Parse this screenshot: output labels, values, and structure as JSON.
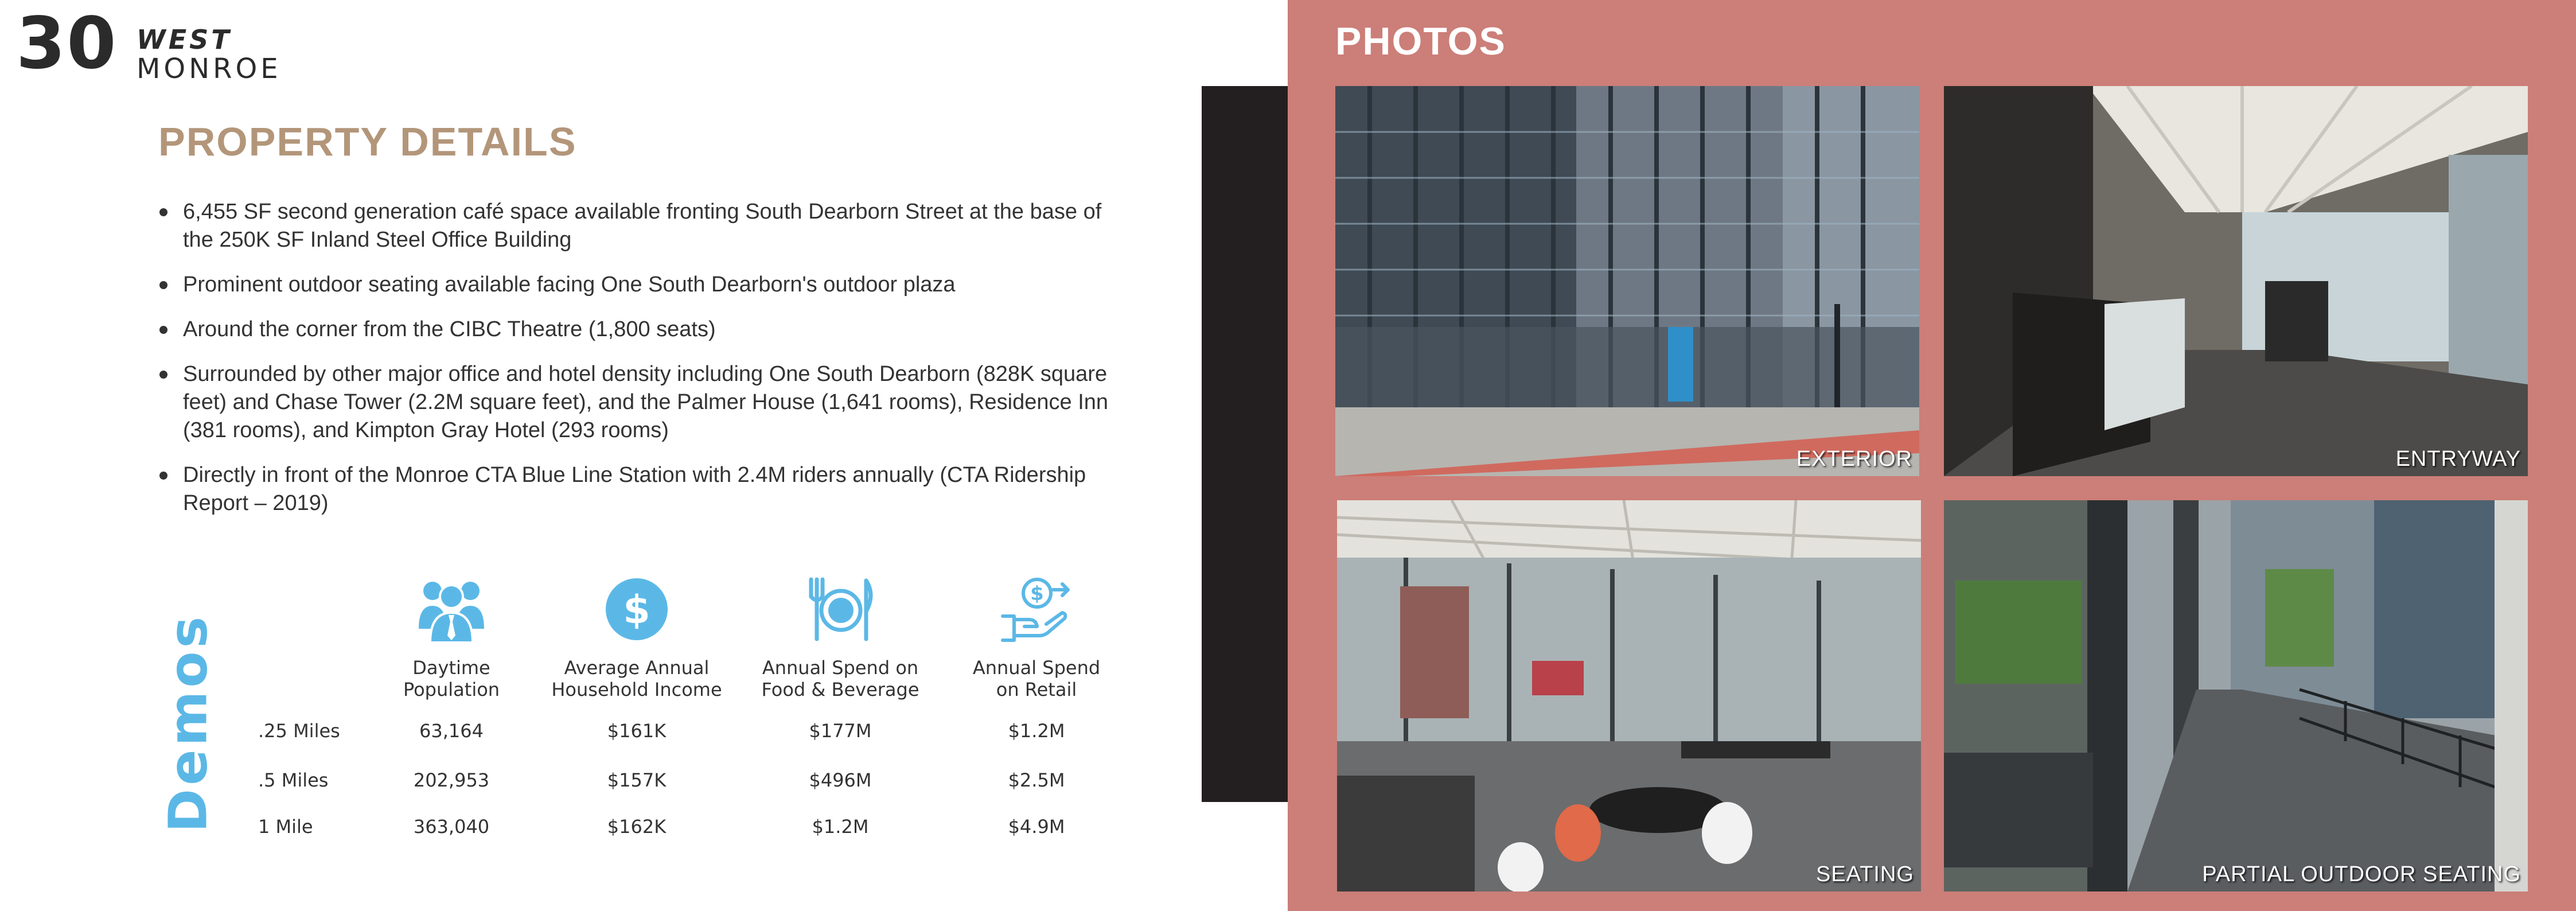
{
  "logo": {
    "number": "30",
    "line1": "WEST",
    "line2": "MONROE"
  },
  "property_details": {
    "title": "PROPERTY DETAILS",
    "bullets": [
      "6,455 SF second generation café space available fronting South Dearborn Street at the base of the 250K SF Inland Steel Office Building",
      "Prominent outdoor seating available facing One South Dearborn's outdoor plaza",
      "Around the corner from the CIBC Theatre (1,800 seats)",
      "Surrounded by other major office and hotel density including One South Dearborn (828K square feet) and Chase Tower (2.2M square feet), and the Palmer House (1,641 rooms), Residence Inn (381 rooms), and Kimpton Gray Hotel (293 rooms)",
      "Directly in front of the Monroe CTA Blue Line Station with 2.4M riders annually (CTA Ridership Report – 2019)"
    ]
  },
  "demos": {
    "label": "Demos",
    "accent_color": "#5bb8e6",
    "columns": [
      {
        "icon": "people-icon",
        "header": "Daytime\nPopulation"
      },
      {
        "icon": "dollar-coin-icon",
        "header": "Average Annual\nHousehold Income"
      },
      {
        "icon": "plate-utensils-icon",
        "header": "Annual Spend on\nFood & Beverage"
      },
      {
        "icon": "hand-money-icon",
        "header": "Annual Spend\non Retail"
      }
    ],
    "rows": [
      {
        "label": ".25 Miles",
        "values": [
          "63,164",
          "$161K",
          "$177M",
          "$1.2M"
        ]
      },
      {
        "label": ".5 Miles",
        "values": [
          "202,953",
          "$157K",
          "$496M",
          "$2.5M"
        ]
      },
      {
        "label": "1 Mile",
        "values": [
          "363,040",
          "$162K",
          "$1.2M",
          "$4.9M"
        ]
      }
    ]
  },
  "photos": {
    "title": "PHOTOS",
    "panel_color": "#cc7e78",
    "items": [
      {
        "caption": "EXTERIOR"
      },
      {
        "caption": "ENTRYWAY"
      },
      {
        "caption": "SEATING"
      },
      {
        "caption": "PARTIAL OUTDOOR SEATING"
      }
    ]
  }
}
